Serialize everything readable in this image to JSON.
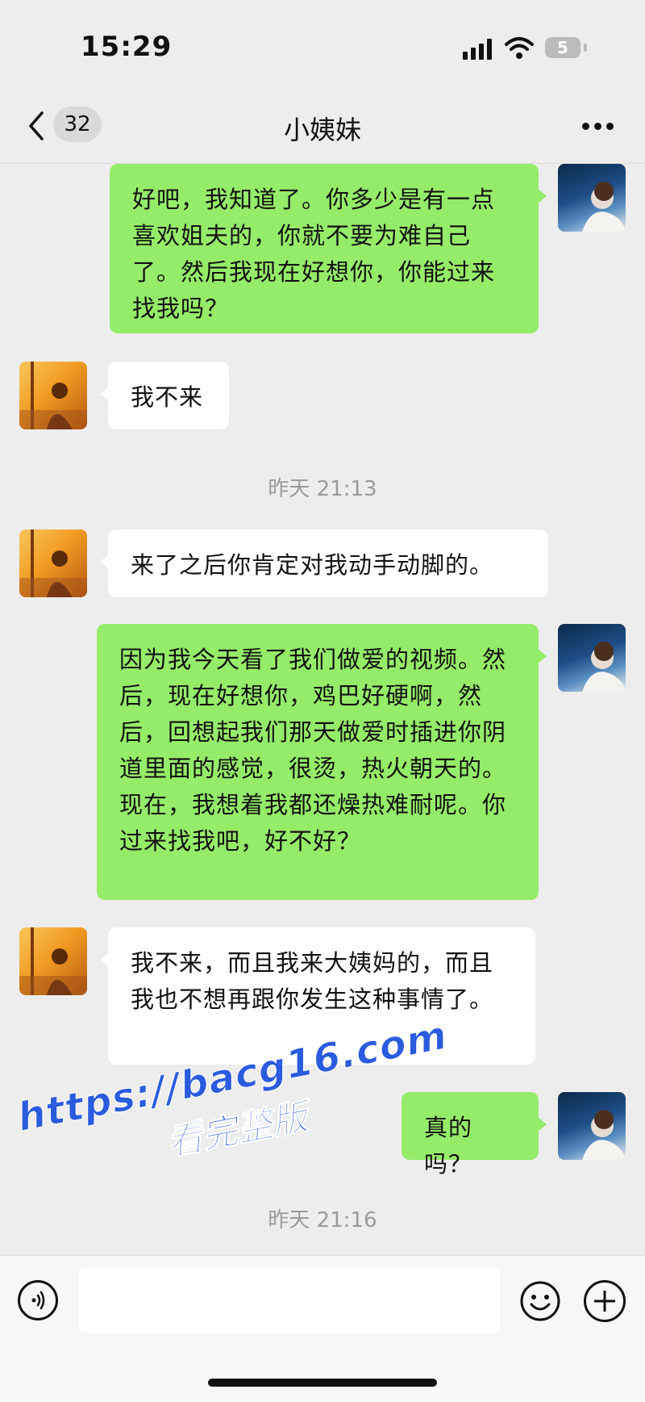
{
  "status_bar": {
    "time": "15:29",
    "battery": "5",
    "signal_icon": "signal-bars-icon",
    "wifi_icon": "wifi-icon"
  },
  "nav": {
    "unread_count": "32",
    "title": "小姨妹",
    "back_icon": "chevron-left-icon",
    "more_icon": "more-dots-icon"
  },
  "messages": [
    {
      "from": "me",
      "text": "好吧，我知道了。你多少是有一点喜欢姐夫的，你就不要为难自己了。然后我现在好想你，你能过来找我吗？"
    },
    {
      "from": "peer",
      "text": "我不来"
    },
    {
      "from": "peer",
      "text": "来了之后你肯定对我动手动脚的。"
    },
    {
      "from": "me",
      "text": "因为我今天看了我们做爱的视频。然后，现在好想你，鸡巴好硬啊，然后，回想起我们那天做爱时插进你阴道里面的感觉，很烫，热火朝天的。现在，我想着我都还燥热难耐呢。你过来找我吧，好不好？"
    },
    {
      "from": "peer",
      "text": "我不来，而且我来大姨妈的，而且我也不想再跟你发生这种事情了。"
    },
    {
      "from": "me",
      "text": "真的吗？"
    }
  ],
  "timestamps": [
    "昨天 21:13",
    "昨天 21:16"
  ],
  "watermark": {
    "url": "https://bacg16.com",
    "subtitle": "看完整版"
  },
  "input_bar": {
    "placeholder": "",
    "voice_icon": "voice-icon",
    "emoji_icon": "emoji-icon",
    "plus_icon": "plus-icon"
  },
  "colors": {
    "background": "#ededed",
    "my_bubble": "#95ec69",
    "peer_bubble": "#ffffff",
    "timestamp": "#9a9a9a",
    "watermark": "#2b5bde"
  }
}
